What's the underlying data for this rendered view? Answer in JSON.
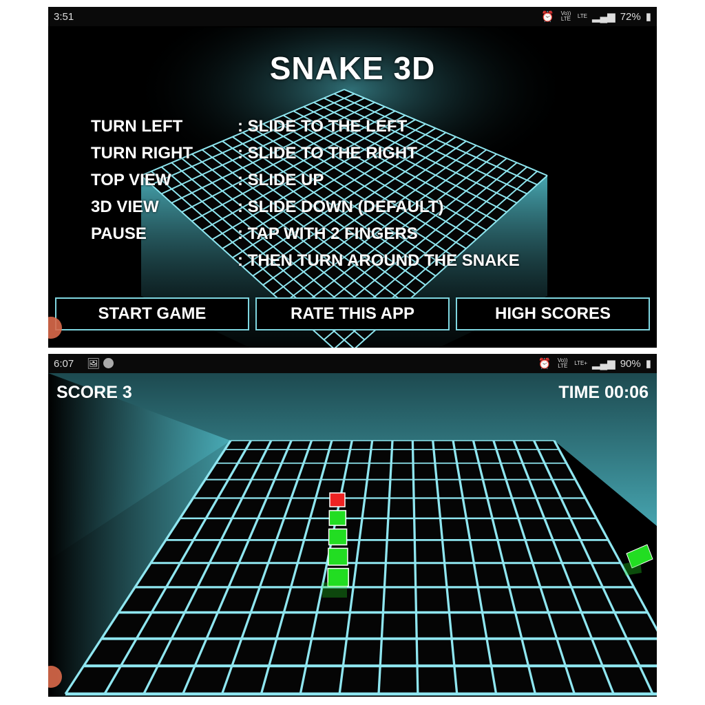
{
  "menu_screen": {
    "status_bar": {
      "time": "3:51",
      "icons": [
        "alarm-icon",
        "volte-icon",
        "lte-icon",
        "signal-icon",
        "signal-icon",
        "battery-icon"
      ],
      "volte": "Vo)) LTE",
      "lte": "LTE",
      "battery": "72%"
    },
    "title": "SNAKE 3D",
    "controls": [
      {
        "action": "TURN LEFT",
        "gesture": ": SLIDE TO THE LEFT"
      },
      {
        "action": "TURN RIGHT",
        "gesture": ": SLIDE TO THE RIGHT"
      },
      {
        "action": "TOP VIEW",
        "gesture": ": SLIDE UP"
      },
      {
        "action": "3D VIEW",
        "gesture": ": SLIDE DOWN (DEFAULT)"
      },
      {
        "action": "PAUSE",
        "gesture": ": TAP WITH 2 FINGERS"
      },
      {
        "action": "",
        "gesture": ": THEN TURN AROUND THE SNAKE"
      }
    ],
    "buttons": {
      "start": "START GAME",
      "rate": "RATE THIS APP",
      "scores": "HIGH SCORES"
    }
  },
  "game_screen": {
    "status_bar": {
      "time": "6:07",
      "icons": [
        "gallery-icon",
        "app-badge-icon",
        "alarm-icon",
        "volte-icon",
        "lte-plus-icon",
        "signal-icon",
        "signal-icon",
        "battery-icon"
      ],
      "volte": "Vo)) LTE",
      "lte": "LTE+",
      "battery": "90%"
    },
    "score": "SCORE 3",
    "time": "TIME 00:06",
    "snake_length": 5
  },
  "colors": {
    "grid": "#8fe6f0",
    "glow": "#4fb8c4",
    "snake": "#22dd22",
    "head": "#ee2222"
  }
}
